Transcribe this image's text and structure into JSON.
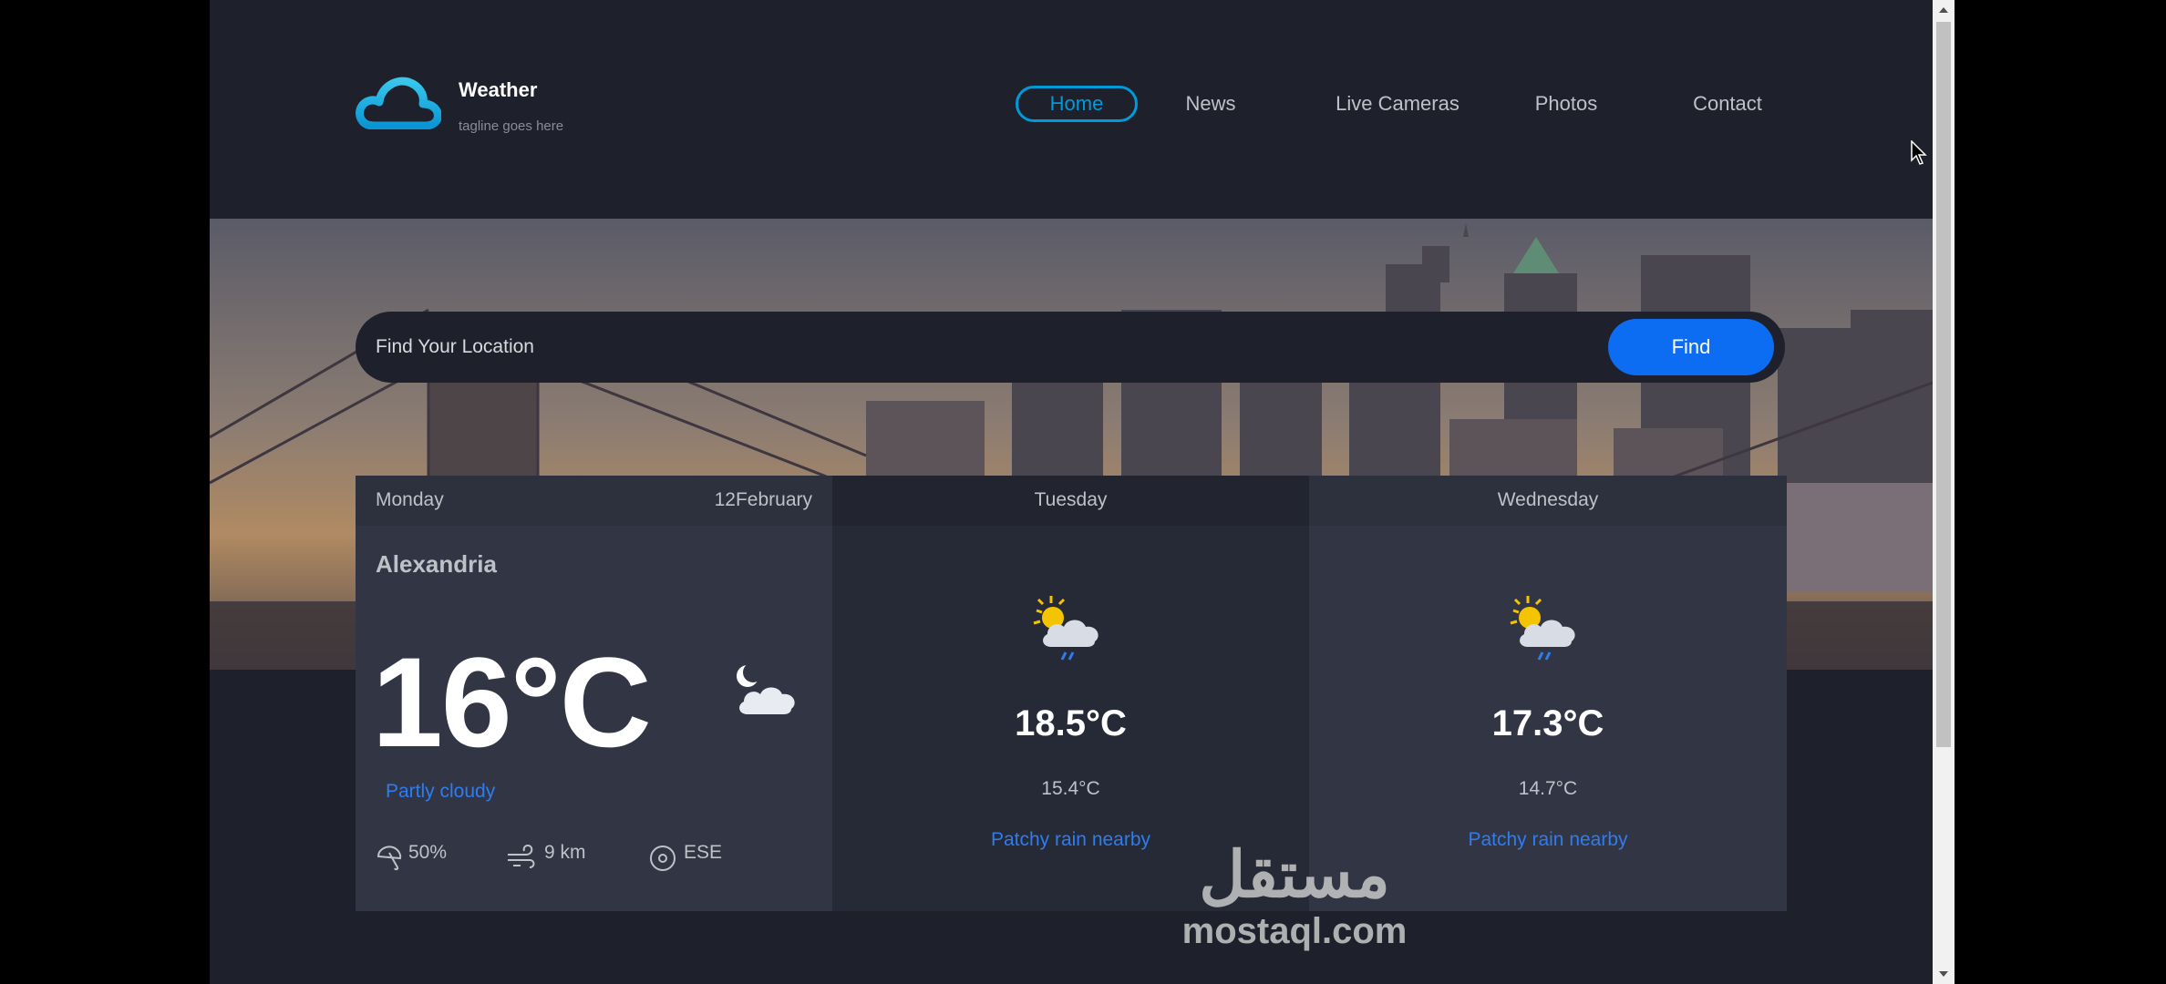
{
  "brand": {
    "title": "Weather",
    "tagline": "tagline goes here"
  },
  "nav": [
    {
      "label": "Home",
      "active": true
    },
    {
      "label": "News"
    },
    {
      "label": "Live Cameras"
    },
    {
      "label": "Photos"
    },
    {
      "label": "Contact"
    }
  ],
  "search": {
    "placeholder": "Find Your Location",
    "button": "Find"
  },
  "forecast": {
    "today": {
      "day": "Monday",
      "date": "12February",
      "city": "Alexandria",
      "temp": "16°C",
      "condition": "Partly cloudy",
      "icon": "night-partly-cloudy-icon",
      "stats": {
        "rain": "50%",
        "wind": "9 km",
        "direction": "ESE"
      }
    },
    "days": [
      {
        "day": "Tuesday",
        "max": "18.5°C",
        "min": "15.4°C",
        "condition": "Patchy rain nearby",
        "icon": "sun-cloud-rain-icon"
      },
      {
        "day": "Wednesday",
        "max": "17.3°C",
        "min": "14.7°C",
        "condition": "Patchy rain nearby",
        "icon": "sun-cloud-rain-icon"
      }
    ]
  },
  "watermark": {
    "arabic": "مستقل",
    "latin": "mostaql.com"
  },
  "colors": {
    "background": "#1e202b",
    "card": "#323544",
    "accent": "#009ad8",
    "button": "#0c6cf2",
    "condition": "#2e7df0"
  }
}
